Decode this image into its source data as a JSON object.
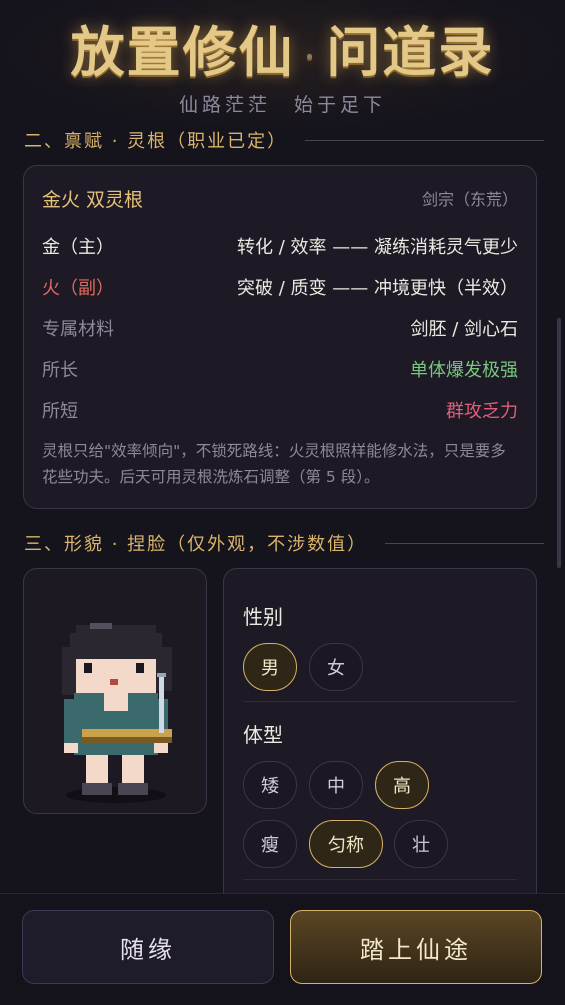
{
  "header": {
    "title_left": "放置修仙",
    "title_sep": "·",
    "title_right": "问道录",
    "subtitle": "仙路茫茫　始于足下"
  },
  "talent_section": {
    "heading": "二、禀赋 · 灵根（职业已定）",
    "root_name": "金火 双灵根",
    "sect": "剑宗（东荒）",
    "rows": [
      {
        "label": "金（主）",
        "value": "转化 / 效率 —— 凝练消耗灵气更少"
      },
      {
        "label": "火（副）",
        "value": "突破 / 质变 —— 冲境更快（半效）"
      },
      {
        "label": "专属材料",
        "value": "剑胚 / 剑心石"
      },
      {
        "label": "所长",
        "value": "单体爆发极强"
      },
      {
        "label": "所短",
        "value": "群攻乏力"
      }
    ],
    "note": "灵根只给\"效率倾向\"，不锁死路线：火灵根照样能修水法，只是要多花些功夫。后天可用灵根洗炼石调整（第 5 段）。"
  },
  "appearance_section": {
    "heading": "三、形貌 · 捏脸（仅外观，不涉数值）",
    "gender": {
      "label": "性别",
      "options": [
        "男",
        "女"
      ],
      "selected": "男"
    },
    "body": {
      "label": "体型",
      "options_row1": [
        "矮",
        "中",
        "高"
      ],
      "options_row2": [
        "瘦",
        "匀称",
        "壮"
      ],
      "selected_height": "高",
      "selected_build": "匀称"
    }
  },
  "footer": {
    "random_label": "随缘",
    "start_label": "踏上仙途"
  },
  "colors": {
    "accent_gold": "#d9b46a",
    "background": "#15131c",
    "strength_green": "#79c77d",
    "weakness_pink": "#e0607a",
    "secondary_red": "#e06a5a"
  },
  "icons": {
    "portrait": "pixel-cultivator-with-sword"
  }
}
